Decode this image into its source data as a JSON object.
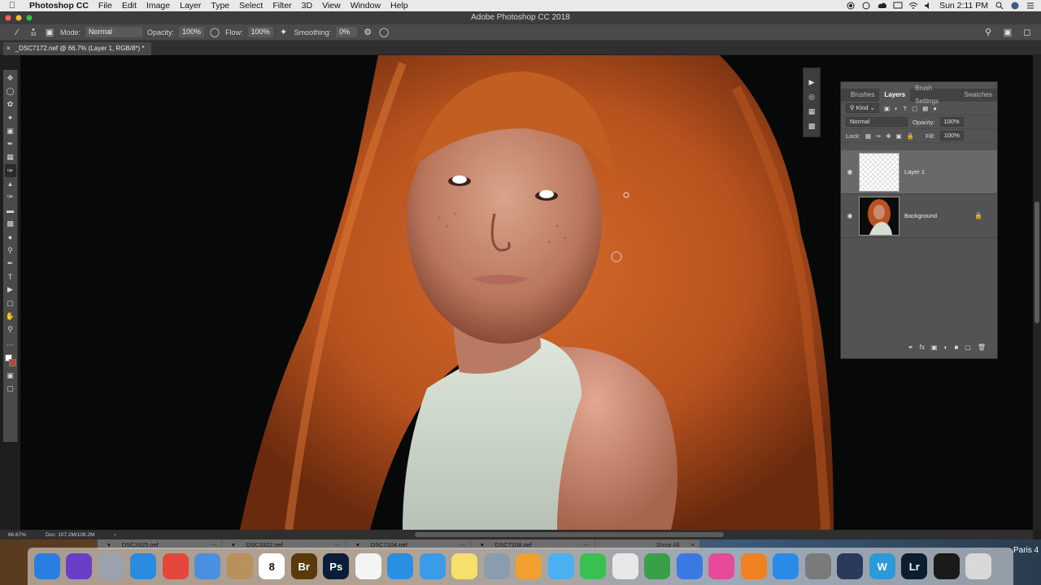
{
  "menubar": {
    "apple": "",
    "app_name": "Photoshop CC",
    "menus": [
      "File",
      "Edit",
      "Image",
      "Layer",
      "Type",
      "Select",
      "Filter",
      "3D",
      "View",
      "Window",
      "Help"
    ],
    "clock": "Sun 2:11 PM"
  },
  "window": {
    "title": "Adobe Photoshop CC 2018"
  },
  "options": {
    "brush_size": "33",
    "mode_label": "Mode:",
    "mode_value": "Normal",
    "opacity_label": "Opacity:",
    "opacity_value": "100%",
    "flow_label": "Flow:",
    "flow_value": "100%",
    "smoothing_label": "Smoothing:",
    "smoothing_value": "0%"
  },
  "document": {
    "tab_label": "_DSC7172.nef @ 66.7% (Layer 1, RGB/8*) *"
  },
  "panel": {
    "tabs": [
      "Brushes",
      "Layers",
      "Brush Settings",
      "Swatches"
    ],
    "active_tab": "Layers",
    "kind_label": "Kind",
    "blend_mode": "Normal",
    "opacity_label": "Opacity:",
    "opacity_value": "100%",
    "lock_label": "Lock:",
    "fill_label": "Fill:",
    "fill_value": "100%",
    "layers": [
      {
        "name": "Layer 1",
        "selected": true,
        "locked": false
      },
      {
        "name": "Background",
        "selected": false,
        "locked": true
      }
    ]
  },
  "status": {
    "zoom": "66.67%",
    "doc_size": "Doc: 107.2M/109.2M"
  },
  "downloads": {
    "items": [
      "DSC3325.nef",
      "DSC3322.nef",
      "DSC7104.nef",
      "DSC7108.nef"
    ],
    "show_all": "Show All"
  },
  "dock": {
    "apps": [
      {
        "name": "Finder",
        "label": "",
        "color": "#2a7de1"
      },
      {
        "name": "Siri",
        "label": "",
        "color": "#6a3fc8"
      },
      {
        "name": "Launchpad",
        "label": "",
        "color": "#9aa3ab"
      },
      {
        "name": "Safari",
        "label": "",
        "color": "#2b8be0"
      },
      {
        "name": "Chrome",
        "label": "",
        "color": "#e3463a"
      },
      {
        "name": "Mail",
        "label": "",
        "color": "#4a8fe0"
      },
      {
        "name": "Contacts",
        "label": "",
        "color": "#b8915a"
      },
      {
        "name": "Calendar",
        "label": "8",
        "color": "#ffffff"
      },
      {
        "name": "Bridge",
        "label": "Br",
        "color": "#5a3a0a"
      },
      {
        "name": "Photoshop",
        "label": "Ps",
        "color": "#0a1e3a"
      },
      {
        "name": "Reminders",
        "label": "",
        "color": "#f4f4f4"
      },
      {
        "name": "Airmail",
        "label": "",
        "color": "#2a8fe0"
      },
      {
        "name": "iCloud",
        "label": "",
        "color": "#3a9be8"
      },
      {
        "name": "Notes",
        "label": "",
        "color": "#f7df6c"
      },
      {
        "name": "Preview",
        "label": "",
        "color": "#8a9db0"
      },
      {
        "name": "Photos",
        "label": "",
        "color": "#f0a030"
      },
      {
        "name": "Messages",
        "label": "",
        "color": "#4ab0f0"
      },
      {
        "name": "FaceTime",
        "label": "",
        "color": "#3ac050"
      },
      {
        "name": "TextEdit",
        "label": "",
        "color": "#e8e8e8"
      },
      {
        "name": "Numbers",
        "label": "",
        "color": "#3aa048"
      },
      {
        "name": "Keynote",
        "label": "",
        "color": "#3a7ae0"
      },
      {
        "name": "iTunes",
        "label": "",
        "color": "#e84a9a"
      },
      {
        "name": "iBooks",
        "label": "",
        "color": "#f08020"
      },
      {
        "name": "App Store",
        "label": "",
        "color": "#2a8ae8"
      },
      {
        "name": "System Preferences",
        "label": "",
        "color": "#7a7a7a"
      },
      {
        "name": "QuickTime",
        "label": "",
        "color": "#2a3a5a"
      },
      {
        "name": "Wunderlist",
        "label": "W",
        "color": "#2a9ad8"
      },
      {
        "name": "Lightroom",
        "label": "Lr",
        "color": "#0a1e2e"
      },
      {
        "name": "Terminal",
        "label": "",
        "color": "#1a1a1a"
      },
      {
        "name": "Trash",
        "label": "",
        "color": "#d8d8d8"
      }
    ],
    "right_label": "Paris 4"
  }
}
